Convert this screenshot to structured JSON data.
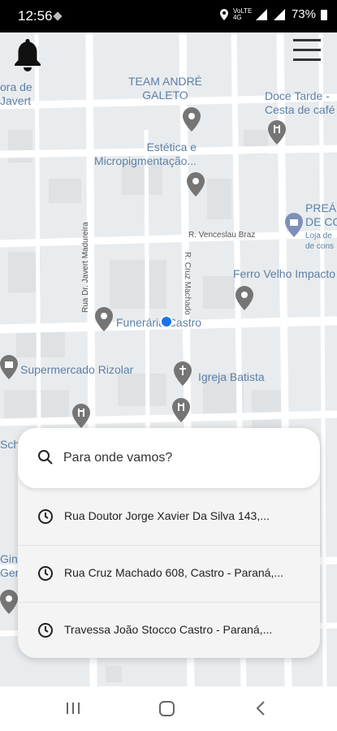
{
  "status_bar": {
    "time": "12:56",
    "indicators": "VoLTE 4G",
    "battery": "73%"
  },
  "map": {
    "places": [
      {
        "id": "ora-de-javert",
        "text": "ora de\nJavert"
      },
      {
        "id": "team-andre-galeto",
        "text": "TEAM ANDRÉ\nGALETO"
      },
      {
        "id": "doce-tarde",
        "text": "Doce Tarde -\nCesta de café"
      },
      {
        "id": "estetica",
        "text": "Estética e\nMicropigmentação..."
      },
      {
        "id": "prea",
        "text": "PREÁ\nDE CO"
      },
      {
        "id": "loja-de-cons",
        "text": "Loja de\nde cons"
      },
      {
        "id": "ferro-velho",
        "text": "Ferro Velho Impacto"
      },
      {
        "id": "funeraria",
        "text": "Funerária Castro"
      },
      {
        "id": "supermercado",
        "text": "Supermercado Rizolar"
      },
      {
        "id": "igreja",
        "text": "Igreja Batista"
      },
      {
        "id": "sch",
        "text": "Sch"
      },
      {
        "id": "gin",
        "text": "Gin\nGer"
      }
    ],
    "streets": [
      {
        "id": "venceslau",
        "text": "R. Venceslau Braz"
      },
      {
        "id": "cruz-machado",
        "text": "R. Cruz Machado"
      },
      {
        "id": "javert",
        "text": "Rua Dr. Javert Madureira"
      }
    ]
  },
  "header": {
    "bell_icon": "bell-icon",
    "menu_icon": "menu-icon"
  },
  "search": {
    "placeholder": "Para onde vamos?"
  },
  "recent": [
    {
      "label": "Rua Doutor Jorge Xavier Da Silva 143,..."
    },
    {
      "label": "Rua Cruz Machado 608, Castro - Paraná,..."
    },
    {
      "label": "Travessa João Stocco Castro - Paraná,..."
    }
  ],
  "colors": {
    "map_bg": "#e9ecee",
    "road": "#ffffff",
    "poi_label": "#5c7fa8",
    "pin": "#757575",
    "location_dot": "#1a73e8"
  }
}
